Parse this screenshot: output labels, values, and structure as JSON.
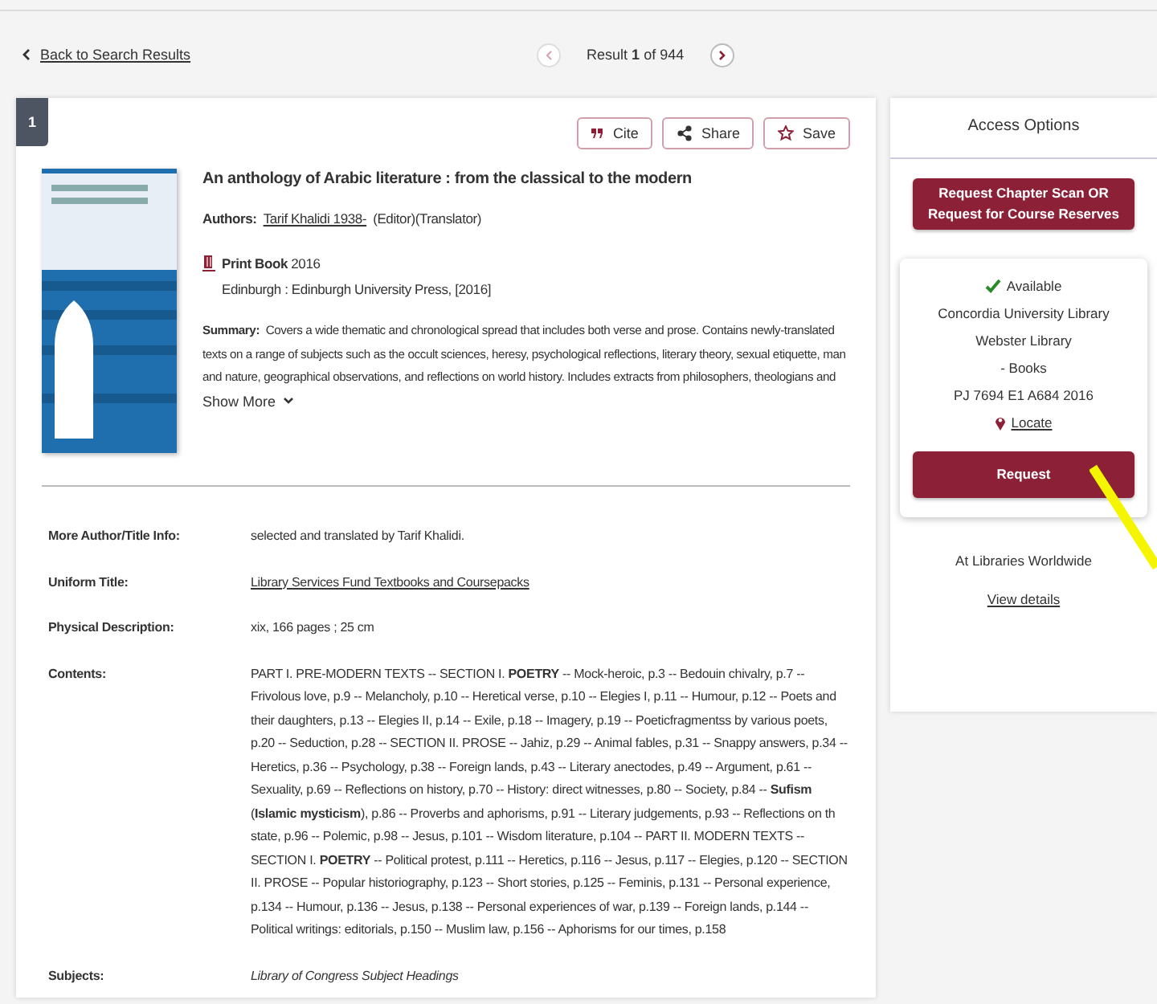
{
  "nav": {
    "back": "Back to Search Results",
    "result_prefix": "Result",
    "result_index": "1",
    "result_of": "of 944",
    "prev_disabled": true,
    "next_disabled": false
  },
  "record": {
    "number": "1",
    "actions": [
      {
        "kind": "cite",
        "label": "Cite"
      },
      {
        "kind": "share",
        "label": "Share"
      },
      {
        "kind": "save",
        "label": "Save"
      }
    ],
    "title": "An anthology of Arabic literature : from the classical to the modern",
    "authors_label": "Authors:",
    "author": "Tarif Khalidi 1938-",
    "author_roles": "(Editor)(Translator)",
    "format": "Print Book",
    "year": "2016",
    "publisher": "Edinburgh : Edinburgh University Press, [2016]",
    "summary_label": "Summary:",
    "summary": "Covers a wide thematic and chronological spread that includes both verse and prose. Contains newly-translated texts on a range of subjects such as the occult sciences, heresy, psychological reflections, literary theory, sexual etiquette, man and nature, geographical observations, and reflections on world history. Includes extracts from philosophers, theologians and",
    "show_more": "Show More",
    "details": [
      {
        "label": "More Author/Title Info:",
        "value": "selected and translated by Tarif Khalidi.",
        "kind": "text"
      },
      {
        "label": "Uniform Title:",
        "value": "Library Services Fund Textbooks and Coursepacks",
        "kind": "link"
      },
      {
        "label": "Physical Description:",
        "value": "xix, 166 pages ; 25 cm",
        "kind": "text"
      },
      {
        "label": "Contents:",
        "value": "PART I. PRE-MODERN TEXTS -- SECTION I. **POETRY** -- Mock-heroic, p.3 -- Bedouin chivalry, p.7 -- Frivolous love, p.9 -- Melancholy, p.10 -- Heretical verse, p.10 -- Elegies I, p.11 -- Humour, p.12 -- Poets and their daughters, p.13 -- Elegies II, p.14 -- Exile, p.18 -- Imagery, p.19 -- Poeticfragmentss by various poets, p.20 -- Seduction, p.28 -- SECTION II. PROSE -- Jahiz, p.29 -- Animal fables, p.31 -- Snappy answers, p.34 -- Heretics, p.36 -- Psychology, p.38 -- Foreign lands, p.43 -- Literary anectodes, p.49 -- Argument, p.61 -- Sexuality, p.69 -- Reflections on history, p.70 -- History: direct witnesses, p.80 -- Society, p.84 -- **Sufism** (**Islamic** **mysticism**), p.86 -- Proverbs and aphorisms, p.91 -- Literary judgements, p.93 -- Reflections on th state, p.96 -- Polemic, p.98 -- Jesus, p.101 -- Wisdom literature, p.104 -- PART II. MODERN TEXTS -- SECTION I. **POETRY** -- Political protest, p.111 -- Heretics, p.116 -- Jesus, p.117 -- Elegies, p.120 -- SECTION II. PROSE -- Popular historiography, p.123 -- Short stories, p.125 -- Feminis, p.131 -- Personal experience, p.134 -- Humour, p.136 -- Jesus, p.138 -- Personal experiences of war, p.139 -- Foreign lands, p.144 -- Political writings: editorials, p.150 -- Muslim law, p.156 -- Aphorisms for our times, p.158",
        "kind": "text"
      },
      {
        "label": "Subjects:",
        "value": "Library of Congress Subject Headings",
        "kind": "italic"
      }
    ]
  },
  "access": {
    "title": "Access Options",
    "request_scan": "Request Chapter Scan OR Request for Course Reserves",
    "holding": {
      "available": true,
      "status": "Available",
      "library": "Concordia University Library",
      "branch": "Webster Library",
      "collection": "- Books",
      "call_number": "PJ 7694 E1 A684 2016",
      "locate": "Locate",
      "request": "Request"
    },
    "worldwide": "At Libraries Worldwide",
    "view_details": "View details"
  }
}
